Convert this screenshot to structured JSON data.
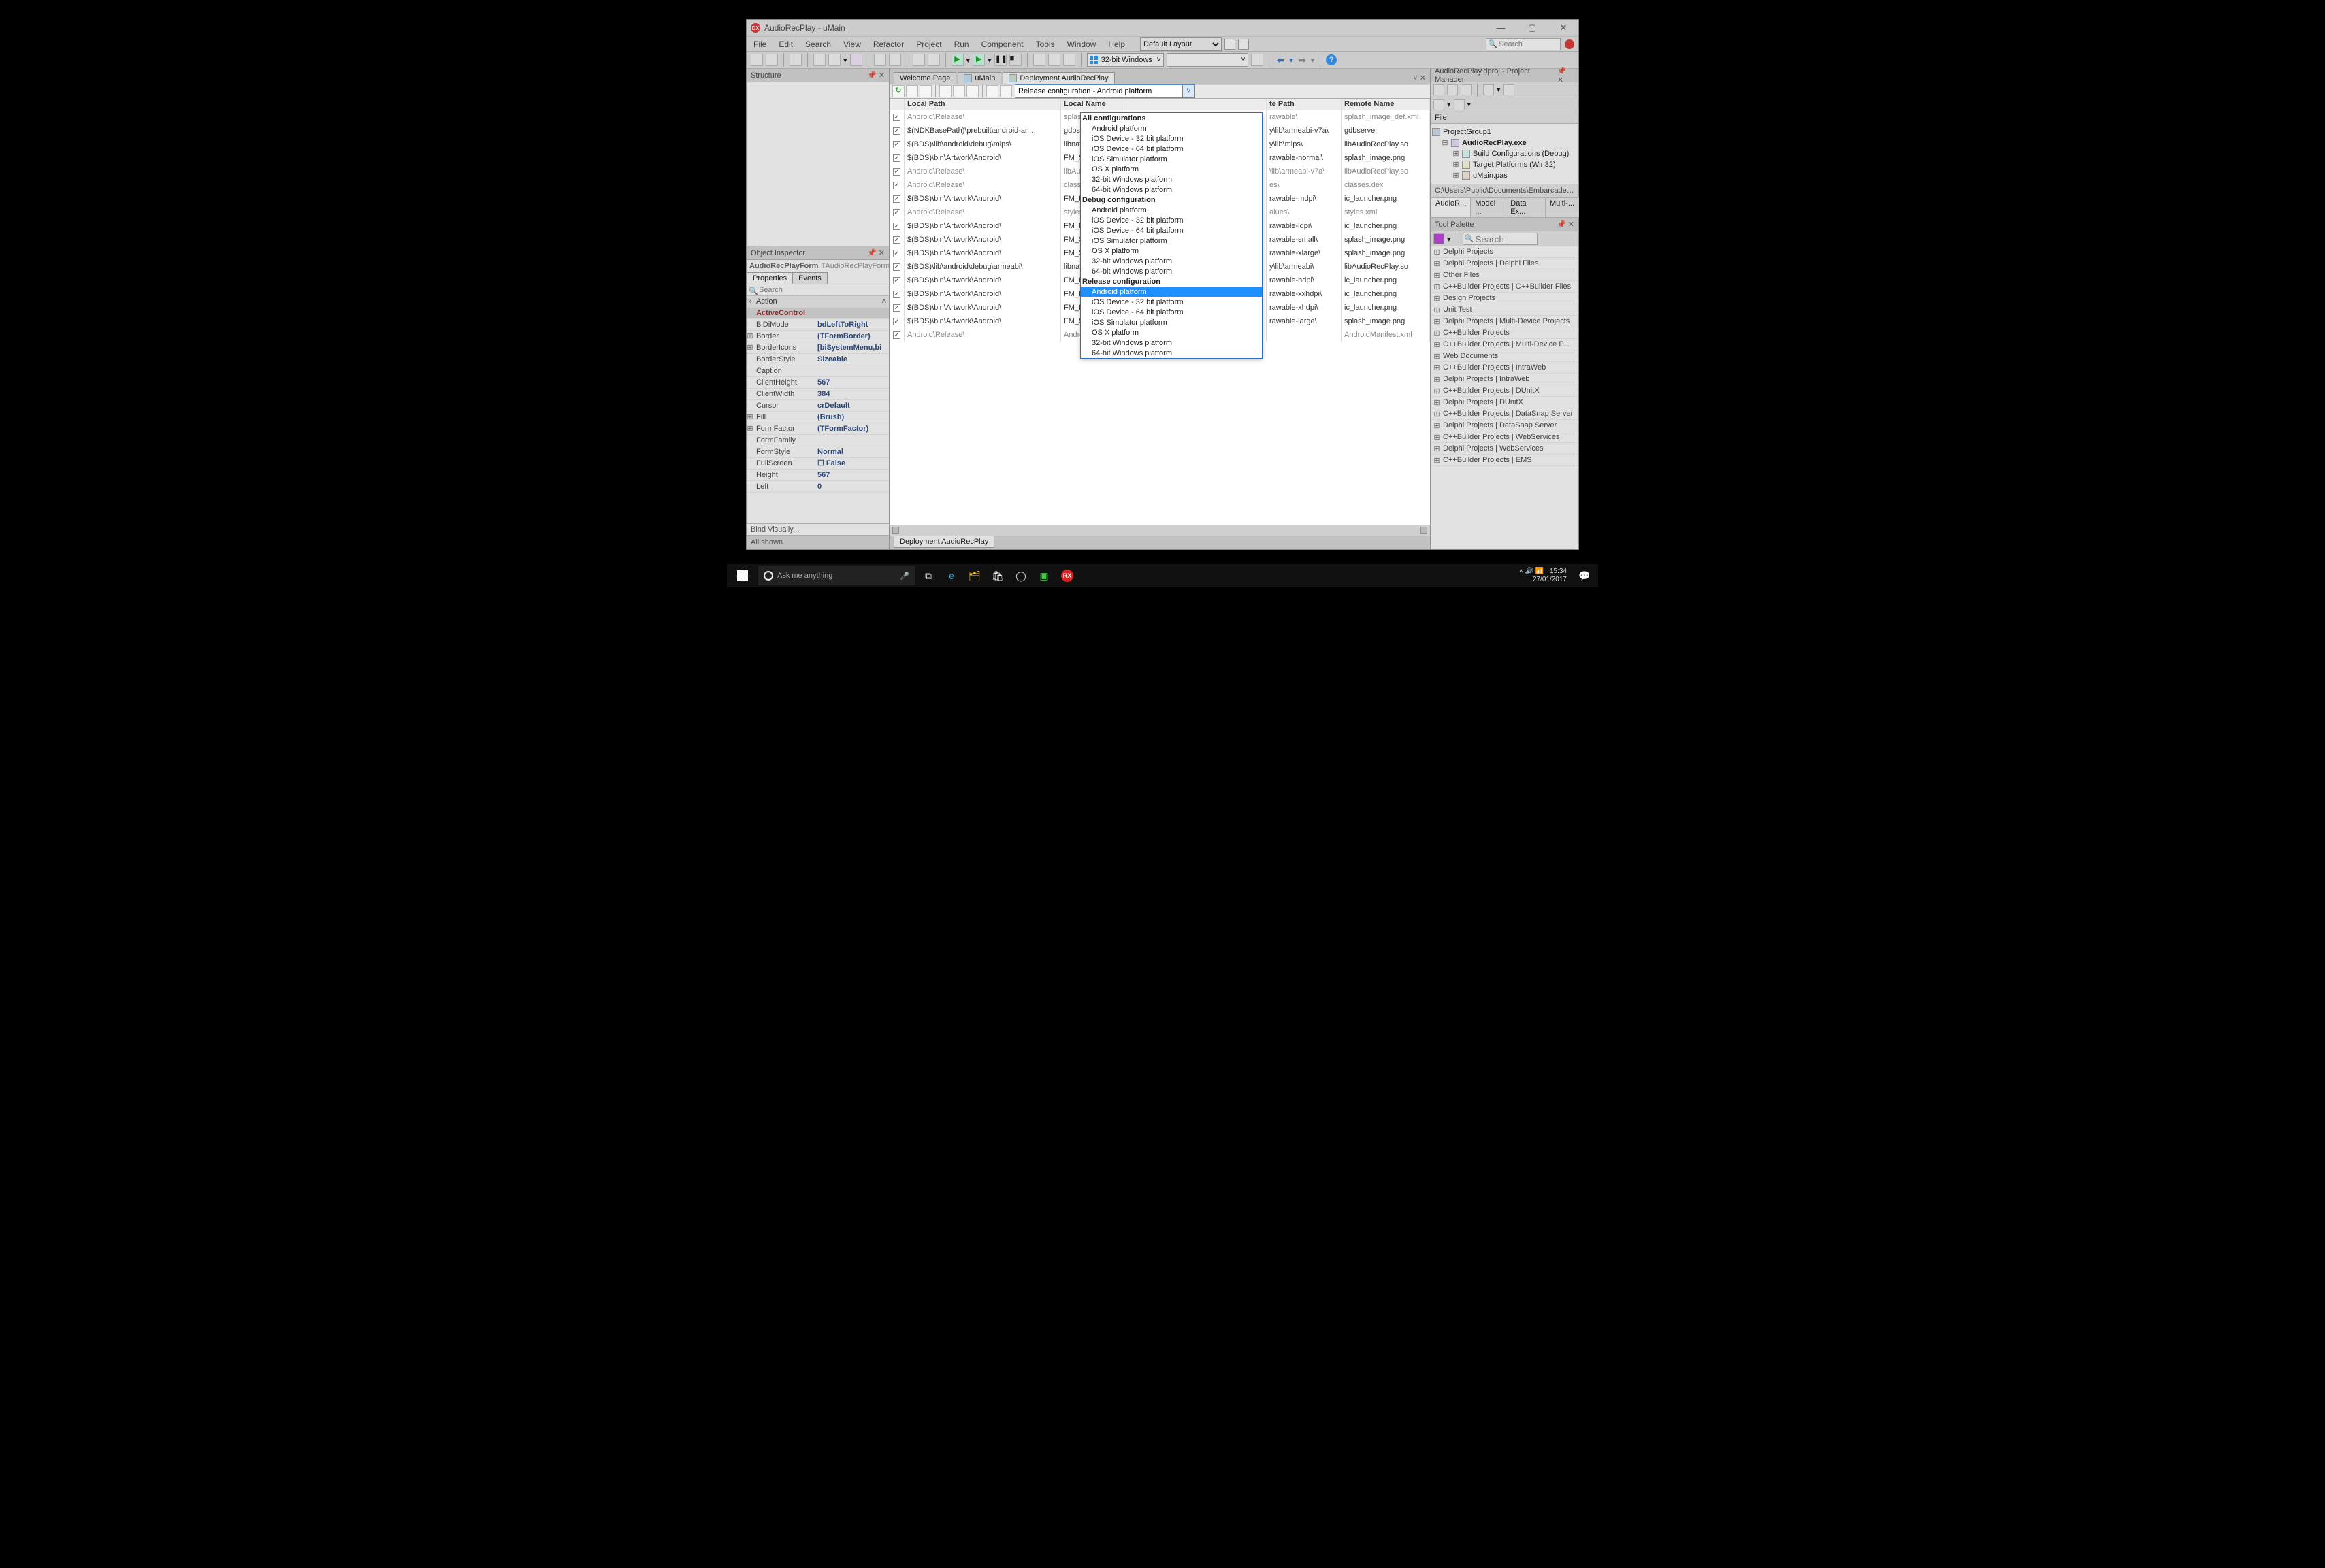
{
  "window": {
    "title": "AudioRecPlay - uMain",
    "min": "—",
    "max": "▢",
    "close": "✕"
  },
  "menu": [
    "File",
    "Edit",
    "Search",
    "View",
    "Refactor",
    "Project",
    "Run",
    "Component",
    "Tools",
    "Window",
    "Help"
  ],
  "layout_select": "Default Layout",
  "topsearch": {
    "placeholder": "Search"
  },
  "platform_select": "32-bit Windows",
  "structure": {
    "title": "Structure"
  },
  "object_inspector": {
    "title": "Object Inspector",
    "selected_name": "AudioRecPlayForm",
    "selected_class": "TAudioRecPlayForm",
    "tab_props": "Properties",
    "tab_events": "Events",
    "search_placeholder": "Search",
    "section": "Action",
    "props": [
      {
        "name": "ActiveControl",
        "val": "",
        "sel": true
      },
      {
        "name": "BiDiMode",
        "val": "bdLeftToRight"
      },
      {
        "name": "Border",
        "val": "(TFormBorder)",
        "exp": true
      },
      {
        "name": "BorderIcons",
        "val": "[biSystemMenu,bi",
        "exp": true
      },
      {
        "name": "BorderStyle",
        "val": "Sizeable"
      },
      {
        "name": "Caption",
        "val": ""
      },
      {
        "name": "ClientHeight",
        "val": "567"
      },
      {
        "name": "ClientWidth",
        "val": "384"
      },
      {
        "name": "Cursor",
        "val": "crDefault"
      },
      {
        "name": "Fill",
        "val": "(Brush)",
        "exp": true
      },
      {
        "name": "FormFactor",
        "val": "(TFormFactor)",
        "exp": true
      },
      {
        "name": "FormFamily",
        "val": ""
      },
      {
        "name": "FormStyle",
        "val": "Normal"
      },
      {
        "name": "FullScreen",
        "val": "False",
        "chk": true
      },
      {
        "name": "Height",
        "val": "567"
      },
      {
        "name": "Left",
        "val": "0"
      }
    ],
    "bind": "Bind Visually...",
    "status": "All shown"
  },
  "tabs": {
    "welcome": "Welcome Page",
    "umain": "uMain",
    "deploy": "Deployment AudioRecPlay"
  },
  "combo_value": "Release configuration - Android platform",
  "grid": {
    "h_localpath": "Local Path",
    "h_localname": "Local Name",
    "h_remotepath": "te Path",
    "h_remotename": "Remote Name",
    "rows": [
      {
        "dis": true,
        "lp": "Android\\Release\\",
        "ln": "splash_image_d",
        "rp": "rawable\\",
        "rn": "splash_image_def.xml"
      },
      {
        "lp": "$(NDKBasePath)\\prebuilt\\android-ar...",
        "ln": "gdbserver",
        "rp": "y\\lib\\armeabi-v7a\\",
        "rn": "gdbserver"
      },
      {
        "lp": "$(BDS)\\lib\\android\\debug\\mips\\",
        "ln": "libnative-activit",
        "rp": "y\\lib\\mips\\",
        "rn": "libAudioRecPlay.so"
      },
      {
        "lp": "$(BDS)\\bin\\Artwork\\Android\\",
        "ln": "FM_SplashImag",
        "rp": "rawable-normal\\",
        "rn": "splash_image.png"
      },
      {
        "dis": true,
        "lp": "Android\\Release\\",
        "ln": "libAudioRecPla",
        "rp": "\\lib\\armeabi-v7a\\",
        "rn": "libAudioRecPlay.so"
      },
      {
        "dis": true,
        "lp": "Android\\Release\\",
        "ln": "classes.dex",
        "rp": "es\\",
        "rn": "classes.dex"
      },
      {
        "lp": "$(BDS)\\bin\\Artwork\\Android\\",
        "ln": "FM_LauncherIc",
        "rp": "rawable-mdpi\\",
        "rn": "ic_launcher.png"
      },
      {
        "dis": true,
        "lp": "Android\\Release\\",
        "ln": "styles.xml",
        "rp": "alues\\",
        "rn": "styles.xml"
      },
      {
        "lp": "$(BDS)\\bin\\Artwork\\Android\\",
        "ln": "FM_LauncherIc",
        "rp": "rawable-ldpi\\",
        "rn": "ic_launcher.png"
      },
      {
        "lp": "$(BDS)\\bin\\Artwork\\Android\\",
        "ln": "FM_SplashImag",
        "rp": "rawable-small\\",
        "rn": "splash_image.png"
      },
      {
        "lp": "$(BDS)\\bin\\Artwork\\Android\\",
        "ln": "FM_SplashImag",
        "rp": "rawable-xlarge\\",
        "rn": "splash_image.png"
      },
      {
        "lp": "$(BDS)\\lib\\android\\debug\\armeabi\\",
        "ln": "libnative-activit",
        "rp": "y\\lib\\armeabi\\",
        "rn": "libAudioRecPlay.so"
      },
      {
        "lp": "$(BDS)\\bin\\Artwork\\Android\\",
        "ln": "FM_LauncherIc",
        "rp": "rawable-hdpi\\",
        "rn": "ic_launcher.png"
      },
      {
        "lp": "$(BDS)\\bin\\Artwork\\Android\\",
        "ln": "FM_LauncherIc",
        "rp": "rawable-xxhdpi\\",
        "rn": "ic_launcher.png"
      },
      {
        "lp": "$(BDS)\\bin\\Artwork\\Android\\",
        "ln": "FM_LauncherIc",
        "rp": "rawable-xhdpi\\",
        "rn": "ic_launcher.png"
      },
      {
        "lp": "$(BDS)\\bin\\Artwork\\Android\\",
        "ln": "FM_SplashImag",
        "rp": "rawable-large\\",
        "rn": "splash_image.png"
      },
      {
        "dis": true,
        "lp": "Android\\Release\\",
        "ln": "AndroidManifes",
        "rp": "",
        "rn": "AndroidManifest.xml"
      }
    ]
  },
  "dropdown": [
    {
      "t": "All configurations",
      "g": true
    },
    {
      "t": "Android platform",
      "s": true
    },
    {
      "t": "iOS Device - 32 bit platform",
      "s": true
    },
    {
      "t": "iOS Device - 64 bit platform",
      "s": true
    },
    {
      "t": "iOS Simulator platform",
      "s": true
    },
    {
      "t": "OS X platform",
      "s": true
    },
    {
      "t": "32-bit Windows platform",
      "s": true
    },
    {
      "t": "64-bit Windows platform",
      "s": true
    },
    {
      "t": "Debug configuration",
      "g": true
    },
    {
      "t": "Android platform",
      "s": true
    },
    {
      "t": "iOS Device - 32 bit platform",
      "s": true
    },
    {
      "t": "iOS Device - 64 bit platform",
      "s": true
    },
    {
      "t": "iOS Simulator platform",
      "s": true
    },
    {
      "t": "OS X platform",
      "s": true
    },
    {
      "t": "32-bit Windows platform",
      "s": true
    },
    {
      "t": "64-bit Windows platform",
      "s": true
    },
    {
      "t": "Release configuration",
      "g": true
    },
    {
      "t": "Android platform",
      "s": true,
      "sel": true
    },
    {
      "t": "iOS Device - 32 bit platform",
      "s": true
    },
    {
      "t": "iOS Device - 64 bit platform",
      "s": true
    },
    {
      "t": "iOS Simulator platform",
      "s": true
    },
    {
      "t": "OS X platform",
      "s": true
    },
    {
      "t": "32-bit Windows platform",
      "s": true
    },
    {
      "t": "64-bit Windows platform",
      "s": true
    }
  ],
  "bottom_tab": "Deployment AudioRecPlay",
  "pm": {
    "title": "AudioRecPlay.dproj - Project Manager",
    "file_label": "File",
    "tree": {
      "root": "ProjectGroup1",
      "proj": "AudioRecPlay.exe",
      "bc": "Build Configurations (Debug)",
      "tp": "Target Platforms (Win32)",
      "unit": "uMain.pas"
    },
    "path": "C:\\Users\\Public\\Documents\\Embarcadero\\St",
    "rtabs": [
      "AudioR...",
      "Model ...",
      "Data Ex...",
      "Multi-..."
    ]
  },
  "palette": {
    "title": "Tool Palette",
    "search_placeholder": "Search",
    "cats": [
      "Delphi Projects",
      "Delphi Projects | Delphi Files",
      "Other Files",
      "C++Builder Projects | C++Builder Files",
      "Design Projects",
      "Unit Test",
      "Delphi Projects | Multi-Device Projects",
      "C++Builder Projects",
      "C++Builder Projects | Multi-Device P...",
      "Web Documents",
      "C++Builder Projects | IntraWeb",
      "Delphi Projects | IntraWeb",
      "C++Builder Projects | DUnitX",
      "Delphi Projects | DUnitX",
      "C++Builder Projects | DataSnap Server",
      "Delphi Projects | DataSnap Server",
      "C++Builder Projects | WebServices",
      "Delphi Projects | WebServices",
      "C++Builder Projects | EMS"
    ]
  },
  "taskbar": {
    "cortana": "Ask me anything",
    "time": "15:34",
    "date": "27/01/2017"
  }
}
